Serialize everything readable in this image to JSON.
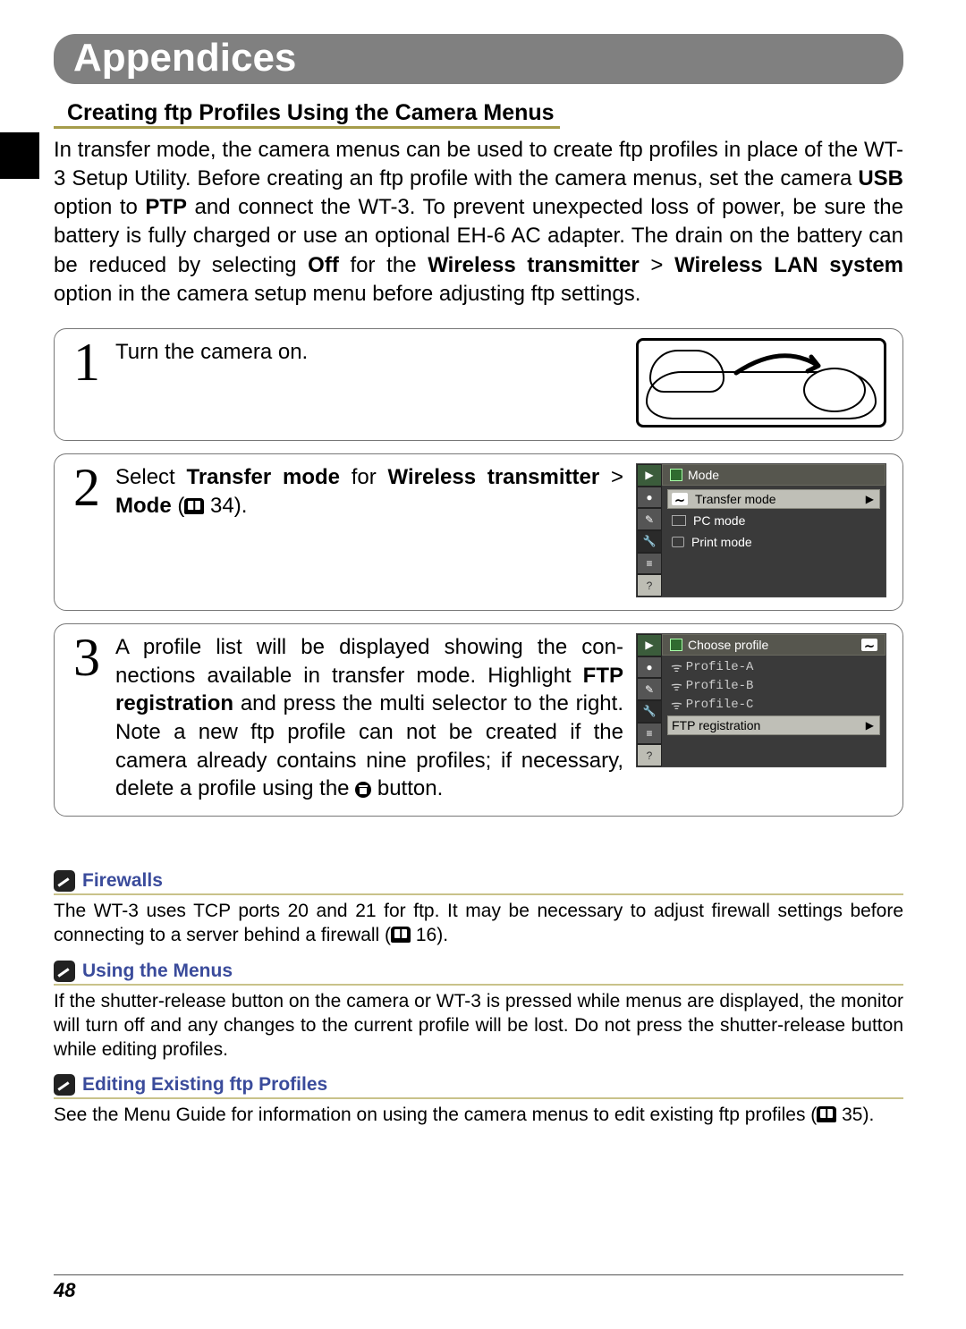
{
  "chapter": "Appendices",
  "section_title": "Creating ftp Profiles Using the Camera Menus",
  "intro_parts": {
    "p1": "In transfer mode, the camera menus can be used to create ftp profiles in place of the WT-3 Setup Utility.  Before creating an ftp profile with the camera menus, set the camera ",
    "b1": "USB",
    "p2": " option to ",
    "b2": "PTP",
    "p3": " and connect the WT-3.  To prevent unexpected loss of power, be sure the battery is fully charged or use an optional EH-6 AC adapter.  The drain on the battery can be reduced by selecting ",
    "b3": "Off",
    "p4": " for the ",
    "b4": "Wireless trans­mitter",
    "p5": " > ",
    "b5": "Wireless LAN system",
    "p6": " option in the camera setup menu before adjusting ftp settings."
  },
  "steps": {
    "s1_num": "1",
    "s1_text": "Turn the camera on.",
    "s2_num": "2",
    "s2_p1": "Select ",
    "s2_b1": "Transfer mode",
    "s2_p2": " for ",
    "s2_b2": "Wireless transmit­ter",
    "s2_p3": " > ",
    "s2_b3": "Mode",
    "s2_p4": " (",
    "s2_ref": " 34).",
    "s3_num": "3",
    "s3_p1": "A profile list will be displayed showing the con­nections available in transfer mode.  Highlight ",
    "s3_b1": "FTP registration",
    "s3_p2": " and press the multi selector to the right.  Note a new ftp profile can not be cre­ated if the camera already contains nine profiles; if necessary, delete a profile using the ",
    "s3_p3": " button."
  },
  "menu1": {
    "header": "Mode",
    "transfer": "Transfer mode",
    "pc": "PC mode",
    "print": "Print mode",
    "q": "?"
  },
  "menu2": {
    "header": "Choose profile",
    "pa": "Profile-A",
    "pb": "Profile-B",
    "pc": "Profile-C",
    "ftp": "FTP registration",
    "q": "?"
  },
  "notes": {
    "n1_title": "Firewalls",
    "n1_body_a": "The WT-3 uses TCP ports 20 and 21 for ftp.  It may be necessary to adjust firewall settings before connecting to a server behind a firewall (",
    "n1_ref": " 16).",
    "n2_title": "Using the Menus",
    "n2_body": "If the shutter-release button on the camera or WT-3 is pressed while menus are displayed, the monitor will turn off and any changes to the current profile will be lost.  Do not press the shutter-release button while editing profiles.",
    "n3_title": "Editing Existing ftp Profiles",
    "n3_body_a": "See the Menu Guide for information on using the camera menus to edit existing ftp profiles (",
    "n3_ref": " 35)."
  },
  "page_number": "48"
}
